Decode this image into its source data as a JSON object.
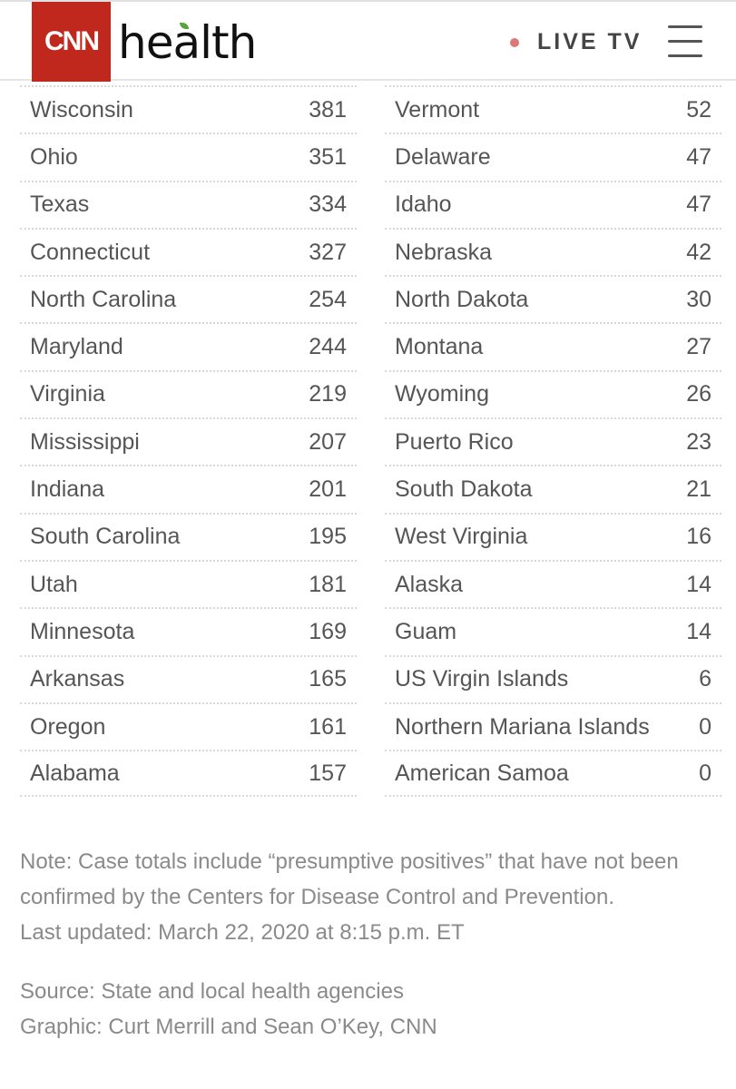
{
  "header": {
    "logo_brand": "CNN",
    "logo_section": "health",
    "live_label": "LIVE TV",
    "live_dot_color": "#d9797a",
    "brand_color": "#c0281d",
    "menu_icon": "hamburger-menu-icon"
  },
  "table": {
    "left": [
      {
        "state": "Wisconsin",
        "cases": "381"
      },
      {
        "state": "Ohio",
        "cases": "351"
      },
      {
        "state": "Texas",
        "cases": "334"
      },
      {
        "state": "Connecticut",
        "cases": "327"
      },
      {
        "state": "North Carolina",
        "cases": "254"
      },
      {
        "state": "Maryland",
        "cases": "244"
      },
      {
        "state": "Virginia",
        "cases": "219"
      },
      {
        "state": "Mississippi",
        "cases": "207"
      },
      {
        "state": "Indiana",
        "cases": "201"
      },
      {
        "state": "South Carolina",
        "cases": "195"
      },
      {
        "state": "Utah",
        "cases": "181"
      },
      {
        "state": "Minnesota",
        "cases": "169"
      },
      {
        "state": "Arkansas",
        "cases": "165"
      },
      {
        "state": "Oregon",
        "cases": "161"
      },
      {
        "state": "Alabama",
        "cases": "157"
      }
    ],
    "right": [
      {
        "state": "Vermont",
        "cases": "52"
      },
      {
        "state": "Delaware",
        "cases": "47"
      },
      {
        "state": "Idaho",
        "cases": "47"
      },
      {
        "state": "Nebraska",
        "cases": "42"
      },
      {
        "state": "North Dakota",
        "cases": "30"
      },
      {
        "state": "Montana",
        "cases": "27"
      },
      {
        "state": "Wyoming",
        "cases": "26"
      },
      {
        "state": "Puerto Rico",
        "cases": "23"
      },
      {
        "state": "South Dakota",
        "cases": "21"
      },
      {
        "state": "West Virginia",
        "cases": "16"
      },
      {
        "state": "Alaska",
        "cases": "14"
      },
      {
        "state": "Guam",
        "cases": "14"
      },
      {
        "state": "US Virgin Islands",
        "cases": "6"
      },
      {
        "state": "Northern Mariana Islands",
        "cases": "0"
      },
      {
        "state": "American Samoa",
        "cases": "0"
      }
    ]
  },
  "footer": {
    "note": "Note: Case totals include “presumptive positives” that have not been confirmed by the Centers for Disease Control and Prevention.",
    "last_updated": "Last updated: March 22, 2020 at 8:15 p.m. ET",
    "source": "Source: State and local health agencies",
    "graphic": "Graphic: Curt Merrill and Sean O’Key, CNN"
  }
}
